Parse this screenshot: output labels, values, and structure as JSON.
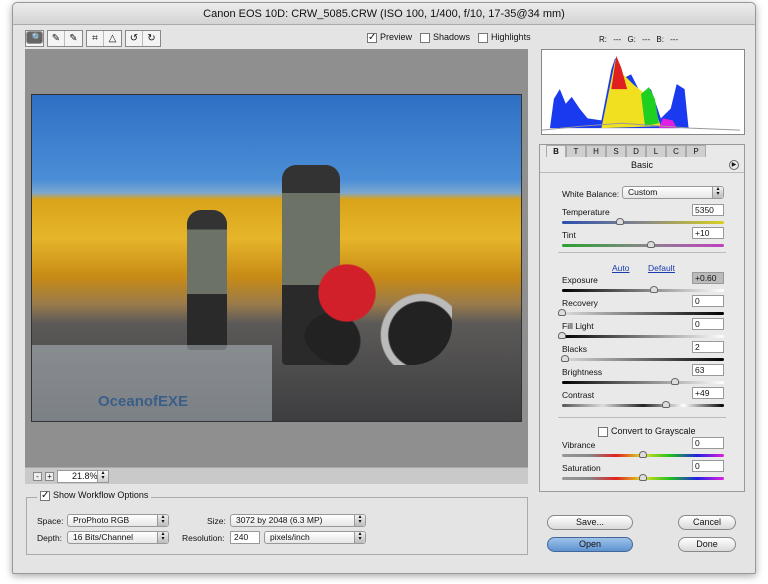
{
  "window": {
    "title": "Canon EOS 10D:  CRW_5085.CRW  (ISO 100, 1/400, f/10, 17-35@34 mm)"
  },
  "toolbar": {
    "tools": [
      {
        "icon": "zoom-icon",
        "glyph": "🔍"
      },
      {
        "icon": "hand-icon",
        "glyph": "✋"
      },
      {
        "icon": "eyedropper-icon",
        "glyph": "✎"
      },
      {
        "icon": "color-sampler-icon",
        "glyph": "✎"
      },
      {
        "icon": "crop-icon",
        "glyph": "⌗"
      },
      {
        "icon": "straighten-icon",
        "glyph": "△"
      },
      {
        "icon": "rotate-left-icon",
        "glyph": "↺"
      },
      {
        "icon": "rotate-right-icon",
        "glyph": "↻"
      }
    ],
    "preview": {
      "label": "Preview",
      "checked": true
    },
    "shadows": {
      "label": "Shadows",
      "checked": false
    },
    "highlights": {
      "label": "Highlights",
      "checked": false
    }
  },
  "readout": {
    "r": "R: ---",
    "g": "G: ---",
    "b": "B: ---"
  },
  "image": {
    "watermark": "OceanofEXE"
  },
  "zoom": {
    "minus": "-",
    "plus": "+",
    "value": "21.8%"
  },
  "workflow": {
    "label": "Show Workflow Options",
    "checked": true,
    "space_label": "Space:",
    "space": "ProPhoto RGB",
    "depth_label": "Depth:",
    "depth": "16 Bits/Channel",
    "size_label": "Size:",
    "size": "3072 by 2048  (6.3 MP)",
    "resolution_label": "Resolution:",
    "resolution": "240",
    "res_unit": "pixels/inch"
  },
  "tabs": [
    "B",
    "T",
    "H",
    "S",
    "D",
    "L",
    "C",
    "P"
  ],
  "panel": {
    "title": "Basic",
    "white_balance_label": "White Balance:",
    "white_balance": "Custom",
    "auto": "Auto",
    "default": "Default",
    "grayscale": "Convert to Grayscale",
    "sliders": [
      {
        "name": "Temperature",
        "value": "5350",
        "pos": 0.36,
        "track": "linear-gradient(90deg,#2a4fb0,#888,#d8d020)"
      },
      {
        "name": "Tint",
        "value": "+10",
        "pos": 0.55,
        "track": "linear-gradient(90deg,#2aa030,#888,#c040c0)"
      },
      {
        "name": "Exposure",
        "value": "+0.60",
        "pos": 0.57,
        "track": "linear-gradient(90deg,#000,#fff)"
      },
      {
        "name": "Recovery",
        "value": "0",
        "pos": 0,
        "track": "linear-gradient(90deg,#ddd,#000)"
      },
      {
        "name": "Fill Light",
        "value": "0",
        "pos": 0,
        "track": "linear-gradient(90deg,#000,#fff)"
      },
      {
        "name": "Blacks",
        "value": "2",
        "pos": 0.02,
        "track": "linear-gradient(90deg,#ddd,#000)"
      },
      {
        "name": "Brightness",
        "value": "63",
        "pos": 0.7,
        "track": "linear-gradient(90deg,#000,#fff)"
      },
      {
        "name": "Contrast",
        "value": "+49",
        "pos": 0.64,
        "track": "linear-gradient(90deg,#555,#ddd,#222,#fff,#000)"
      },
      {
        "name": "Vibrance",
        "value": "0",
        "pos": 0.5,
        "track": "linear-gradient(90deg,#999,#888,#e02020,#e0e020,#20c020,#2020e0,#e020e0)"
      },
      {
        "name": "Saturation",
        "value": "0",
        "pos": 0.5,
        "track": "linear-gradient(90deg,#999,#888,#e02020,#e0e020,#20c020,#2020e0,#e020e0)"
      }
    ]
  },
  "buttons": {
    "save": "Save...",
    "cancel": "Cancel",
    "open": "Open",
    "done": "Done"
  }
}
